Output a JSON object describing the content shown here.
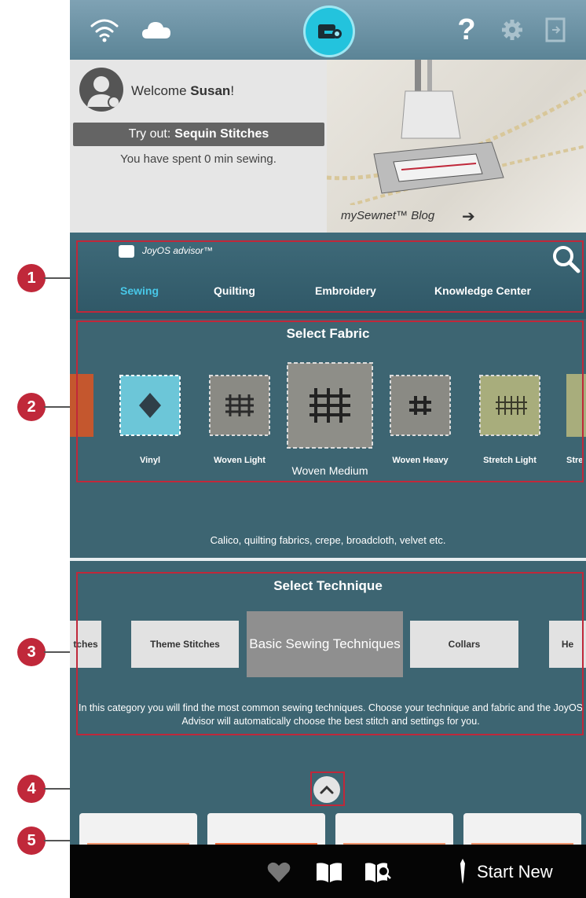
{
  "topbar": {
    "help_label": "?"
  },
  "welcome": {
    "greeting": "Welcome",
    "user_name": "Susan",
    "punct": "!",
    "tryout_prefix": "Try out:",
    "tryout_name": "Sequin Stitches",
    "spent_text": "You have spent 0 min sewing."
  },
  "blog": {
    "label": "mySewnet™ Blog",
    "arrow": "➔"
  },
  "advisor": {
    "title": "JoyOS advisor™",
    "tabs": [
      "Sewing",
      "Quilting",
      "Embroidery",
      "Knowledge Center"
    ],
    "active_tab": "Sewing"
  },
  "fabric": {
    "title": "Select Fabric",
    "items": [
      "Vinyl",
      "Woven Light",
      "Woven Medium",
      "Woven Heavy",
      "Stretch Light",
      "Stre"
    ],
    "selected": "Woven Medium",
    "description": "Calico, quilting fabrics, crepe, broadcloth, velvet etc."
  },
  "technique": {
    "title": "Select Technique",
    "items": [
      "tches",
      "Theme Stitches",
      "Basic Sewing Techniques",
      "Collars",
      "He"
    ],
    "selected": "Basic Sewing Techniques",
    "description": "In this category you will find the most common sewing techniques. Choose your technique and fabric and the JoyOS Advisor will automatically choose the best stitch and settings for you."
  },
  "bottom": {
    "start_label": "Start New"
  },
  "callouts": [
    "1",
    "2",
    "3",
    "4",
    "5"
  ],
  "colors": {
    "accent": "#48c8e8",
    "callout": "#c0283a",
    "panel": "#3d6572"
  }
}
